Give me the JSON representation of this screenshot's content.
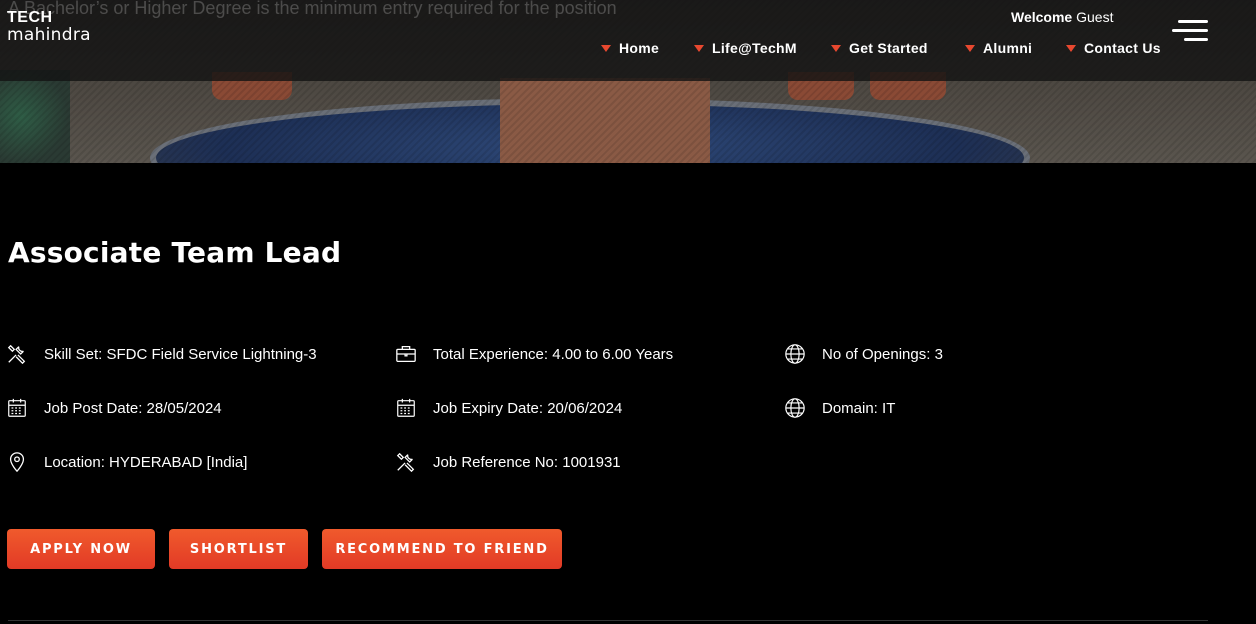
{
  "hero": {
    "ghost_text": "A Bachelor’s or Higher Degree is the minimum entry required for the position"
  },
  "header": {
    "logo_line1": "TECH",
    "logo_line2": "mahindra",
    "welcome_label": "Welcome",
    "welcome_user": "Guest",
    "nav": [
      {
        "label": "Home"
      },
      {
        "label": "Life@TechM"
      },
      {
        "label": "Get Started"
      },
      {
        "label": "Alumni"
      },
      {
        "label": "Contact Us"
      }
    ],
    "accent_color": "#e8482f"
  },
  "job": {
    "title": "Associate Team Lead",
    "details": [
      {
        "icon": "tools-icon",
        "text": "Skill Set: SFDC Field Service Lightning-3"
      },
      {
        "icon": "briefcase-icon",
        "text": "Total Experience: 4.00 to 6.00 Years"
      },
      {
        "icon": "globe-icon",
        "text": "No of Openings: 3"
      },
      {
        "icon": "calendar-icon",
        "text": "Job Post Date: 28/05/2024"
      },
      {
        "icon": "calendar-icon",
        "text": "Job Expiry Date: 20/06/2024"
      },
      {
        "icon": "globe-icon",
        "text": "Domain: IT"
      },
      {
        "icon": "location-pin-icon",
        "text": "Location: HYDERABAD [India]"
      },
      {
        "icon": "tools-icon",
        "text": "Job Reference No: 1001931"
      }
    ]
  },
  "actions": {
    "apply": "APPLY NOW",
    "shortlist": "SHORTLIST",
    "recommend": "RECOMMEND TO FRIEND",
    "button_color": "#e8402a"
  }
}
